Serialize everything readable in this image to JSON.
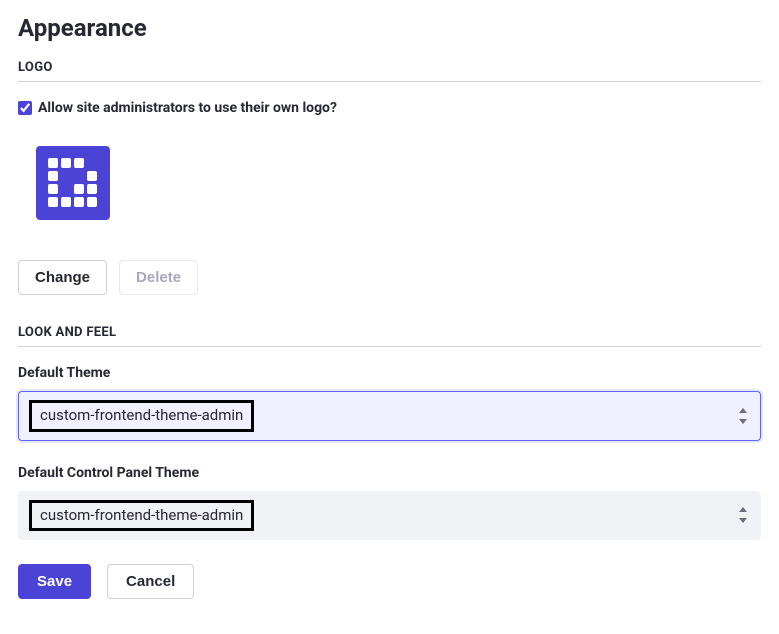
{
  "page": {
    "title": "Appearance"
  },
  "sections": {
    "logo": {
      "header": "LOGO",
      "checkbox_label": "Allow site administrators to use their own logo?",
      "checkbox_checked": true,
      "change_label": "Change",
      "delete_label": "Delete"
    },
    "look": {
      "header": "LOOK AND FEEL",
      "default_theme": {
        "label": "Default Theme",
        "value": "custom-frontend-theme-admin"
      },
      "default_cp_theme": {
        "label": "Default Control Panel Theme",
        "value": "custom-frontend-theme-admin"
      }
    }
  },
  "footer": {
    "save_label": "Save",
    "cancel_label": "Cancel"
  }
}
